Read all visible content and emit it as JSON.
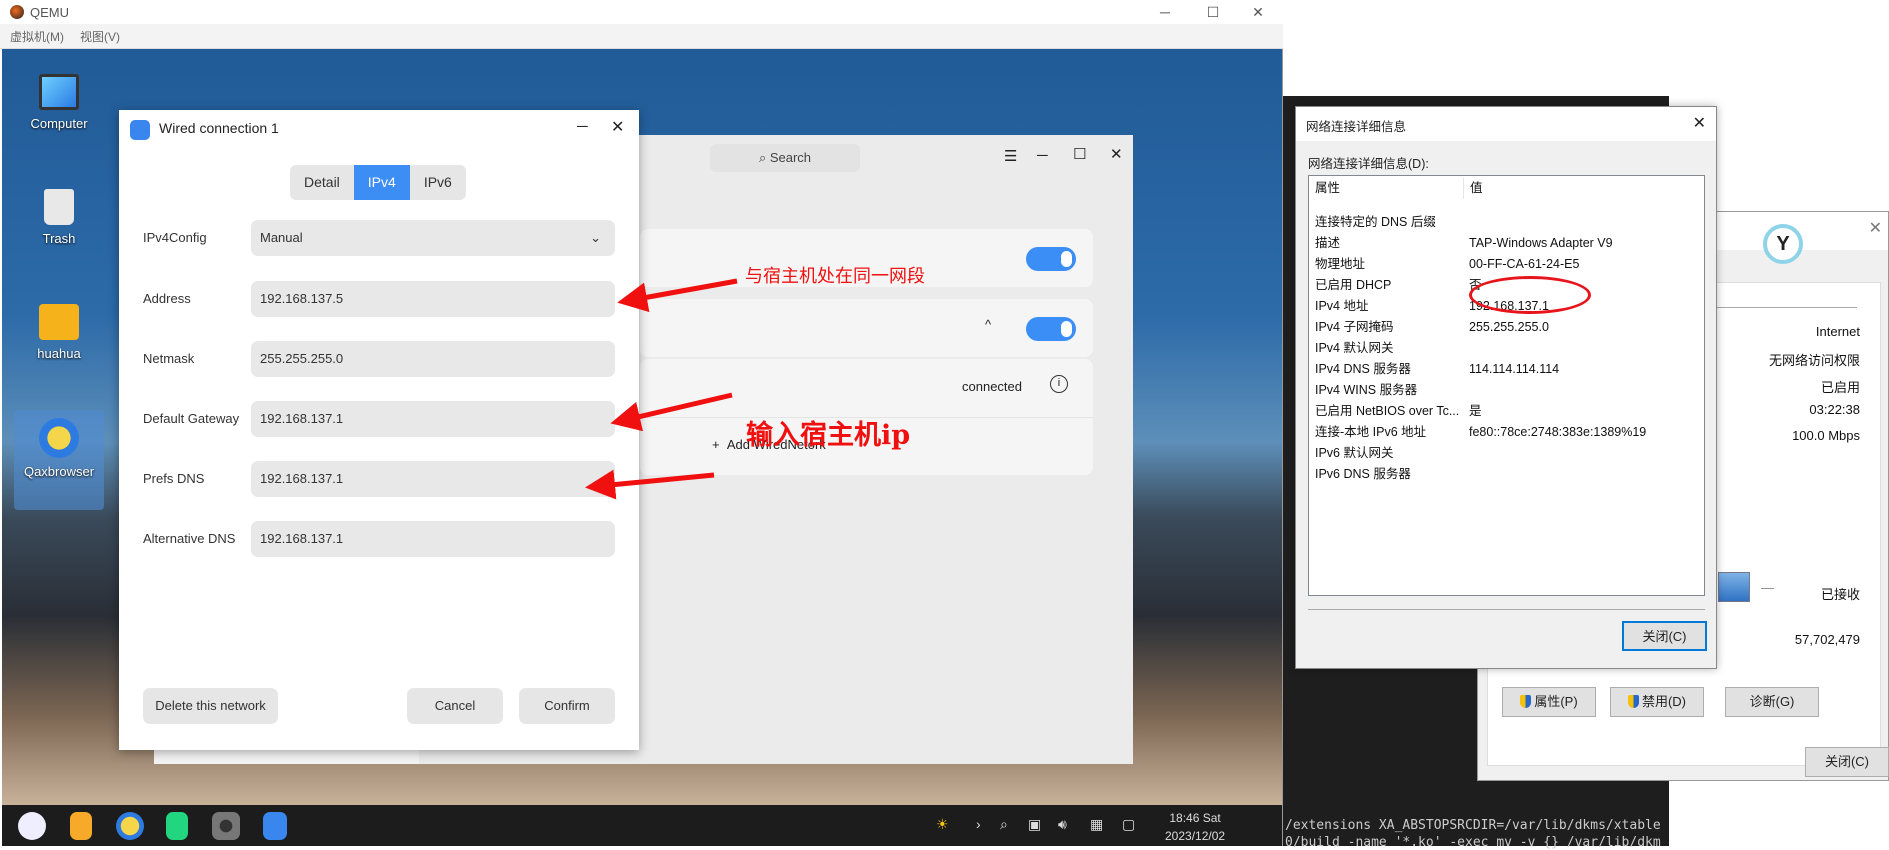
{
  "qemu": {
    "title": "QEMU",
    "menu": [
      "虚拟机(M)",
      "视图(V)"
    ]
  },
  "desktop": {
    "icons": [
      {
        "label": "Computer",
        "icon": "monitor-icon"
      },
      {
        "label": "Trash",
        "icon": "trash-icon"
      },
      {
        "label": "huahua",
        "icon": "folder-icon"
      },
      {
        "label": "Qaxbrowser",
        "icon": "browser-icon"
      }
    ]
  },
  "taskbar": {
    "apps": [
      "launcher-icon",
      "notes-icon",
      "qaxbrowser-icon",
      "app-store-icon",
      "settings-icon",
      "network-icon"
    ],
    "time": "18:46 Sat",
    "date": "2023/12/02",
    "tray": [
      "sun-icon",
      "chevron-right-icon",
      "search-icon",
      "network-tray-icon",
      "volume-icon",
      "keyboard-icon",
      "notification-icon"
    ]
  },
  "bgwin": {
    "search": "Search",
    "status": "connected",
    "add": "Add WiredNetork"
  },
  "wired": {
    "title": "Wired connection 1",
    "tabs": [
      "Detail",
      "IPv4",
      "IPv6"
    ],
    "active_tab": "IPv4",
    "fields": [
      {
        "label": "IPv4Config",
        "value": "Manual"
      },
      {
        "label": "Address",
        "value": "192.168.137.5"
      },
      {
        "label": "Netmask",
        "value": "255.255.255.0"
      },
      {
        "label": "Default Gateway",
        "value": "192.168.137.1"
      },
      {
        "label": "Prefs DNS",
        "value": "192.168.137.1"
      },
      {
        "label": "Alternative DNS",
        "value": "192.168.137.1"
      }
    ],
    "delete": "Delete this network",
    "cancel": "Cancel",
    "confirm": "Confirm"
  },
  "annotations": {
    "same_segment": "与宿主机处在同一网段",
    "enter_host_ip": "输入宿主机ip",
    "color": "#f01010"
  },
  "terminal": {
    "lines": [
      "/extensions XA_ABSTOPSRCDIR=/var/lib/dkms/xtable",
      "0/build -name '*.ko' -exec mv -v {} /var/lib/dkm"
    ]
  },
  "status_win": {
    "values": [
      "Internet",
      "无网络访问权限",
      "已启用",
      "03:22:38",
      "100.0 Mbps"
    ],
    "received_label": "已接收",
    "received": "57,702,479",
    "dash": "—",
    "buttons": [
      "属性(P)",
      "禁用(D)",
      "诊断(G)"
    ],
    "close": "关闭(C)"
  },
  "details": {
    "title": "网络连接详细信息",
    "caption": "网络连接详细信息(D):",
    "headers": [
      "属性",
      "值"
    ],
    "rows": [
      [
        "连接特定的 DNS 后缀",
        ""
      ],
      [
        "描述",
        "TAP-Windows Adapter V9"
      ],
      [
        "物理地址",
        "00-FF-CA-61-24-E5"
      ],
      [
        "已启用 DHCP",
        "否"
      ],
      [
        "IPv4 地址",
        "192.168.137.1"
      ],
      [
        "IPv4 子网掩码",
        "255.255.255.0"
      ],
      [
        "IPv4 默认网关",
        ""
      ],
      [
        "IPv4 DNS 服务器",
        "114.114.114.114"
      ],
      [
        "IPv4 WINS 服务器",
        ""
      ],
      [
        "已启用 NetBIOS over Tc...",
        "是"
      ],
      [
        "连接-本地 IPv6 地址",
        "fe80::78ce:2748:383e:1389%19"
      ],
      [
        "IPv6 默认网关",
        ""
      ],
      [
        "IPv6 DNS 服务器",
        ""
      ]
    ],
    "close": "关闭(C)"
  }
}
